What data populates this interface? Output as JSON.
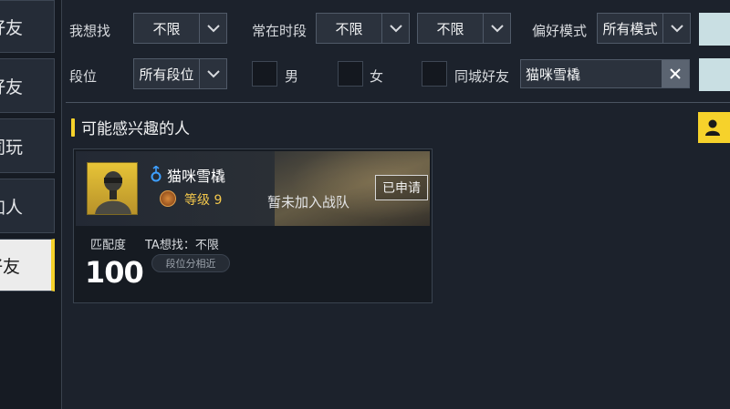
{
  "sidebar": {
    "items": [
      {
        "label": "好友",
        "active": false
      },
      {
        "label": "好友",
        "active": false
      },
      {
        "label": "同玩",
        "active": false
      },
      {
        "label": "加人",
        "active": false
      },
      {
        "label": "好友",
        "active": true
      }
    ]
  },
  "filters": {
    "want_label": "我想找",
    "want_value": "不限",
    "time_label": "常在时段",
    "time_value_1": "不限",
    "time_value_2": "不限",
    "mode_label": "偏好模式",
    "mode_value": "所有模式",
    "rank_label": "段位",
    "rank_value": "所有段位",
    "male_label": "男",
    "female_label": "女",
    "same_city_label": "同城好友",
    "search_value": "猫咪雪橇"
  },
  "section": {
    "title": "可能感兴趣的人"
  },
  "card": {
    "player_name": "猫咪雪橇",
    "level": "等级 9",
    "team_status": "暂未加入战队",
    "applied_label": "已申请",
    "match_label": "匹配度",
    "match_value": "100",
    "ta_want": "TA想找：不限",
    "tag": "段位分相近"
  },
  "colors": {
    "accent": "#f6d22b",
    "background": "#1c222c",
    "gender_male": "#3ea0ff"
  },
  "icons": {
    "dropdown": "chevron-down-icon",
    "clear": "close-icon",
    "gender": "male-gender-icon",
    "rank": "bronze-rank-icon",
    "invite": "person-icon"
  }
}
